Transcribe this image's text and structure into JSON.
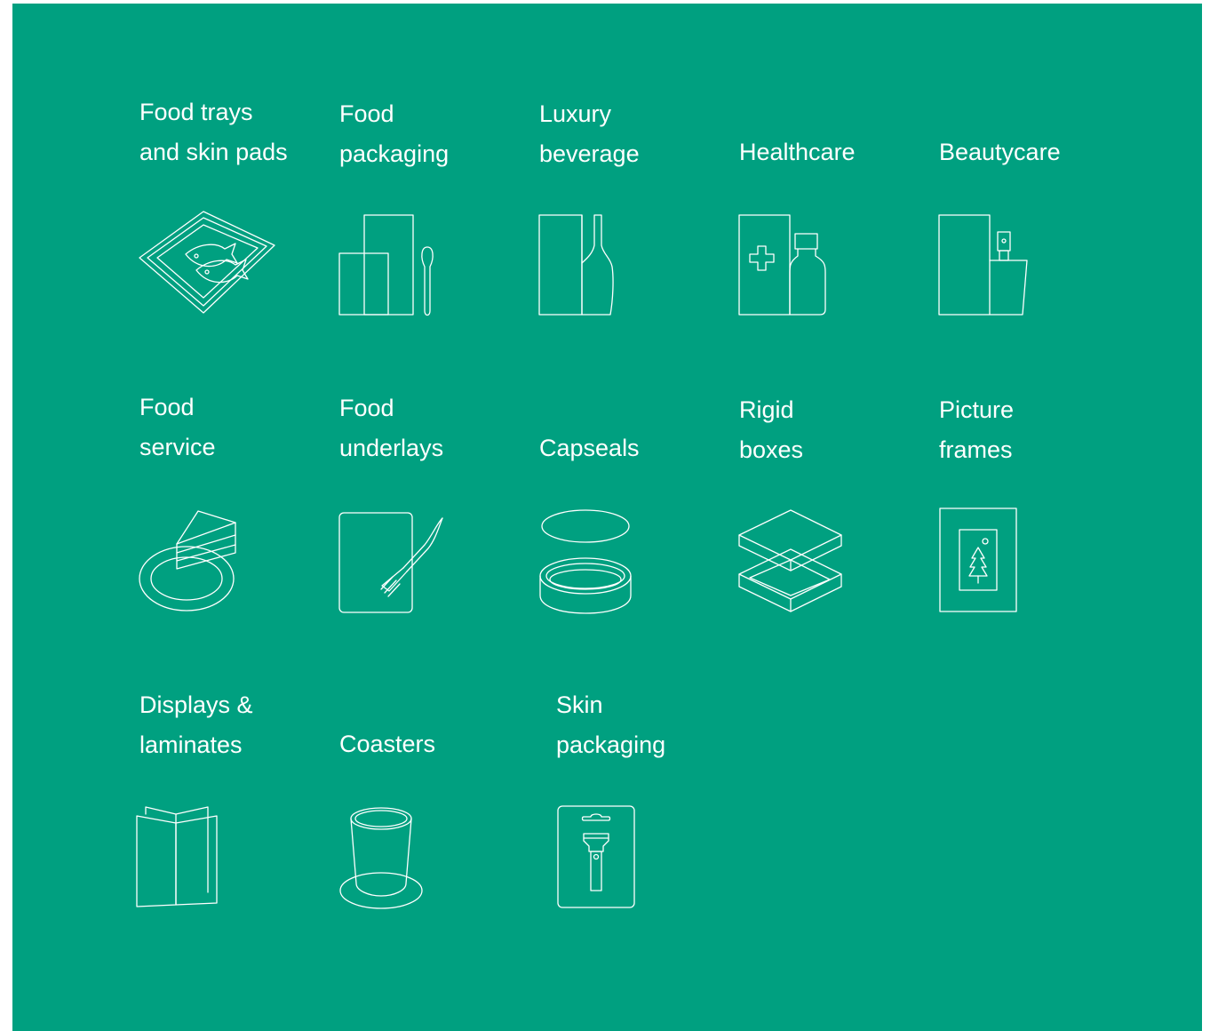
{
  "colors": {
    "background": "#00a080",
    "line": "#ffffff"
  },
  "items": [
    {
      "label": "Food trays\nand skin pads",
      "icon": "fish-tray-icon"
    },
    {
      "label": "Food\npackaging",
      "icon": "carton-spoon-icon"
    },
    {
      "label": "Luxury\nbeverage",
      "icon": "box-bottle-icon"
    },
    {
      "label": "Healthcare",
      "icon": "medicine-box-bottle-icon"
    },
    {
      "label": "Beautycare",
      "icon": "box-perfume-icon"
    },
    {
      "label": "Food\nservice",
      "icon": "cake-plate-icon"
    },
    {
      "label": "Food\nunderlays",
      "icon": "tray-fork-icon"
    },
    {
      "label": "Capseals",
      "icon": "lid-cap-icon"
    },
    {
      "label": "Rigid\nboxes",
      "icon": "rigid-box-icon"
    },
    {
      "label": "Picture\nframes",
      "icon": "picture-frame-icon"
    },
    {
      "label": "Displays &\nlaminates",
      "icon": "folded-display-icon"
    },
    {
      "label": "Coasters",
      "icon": "cup-coaster-icon"
    },
    {
      "label": "Skin\npackaging",
      "icon": "blister-flashlight-icon"
    }
  ]
}
